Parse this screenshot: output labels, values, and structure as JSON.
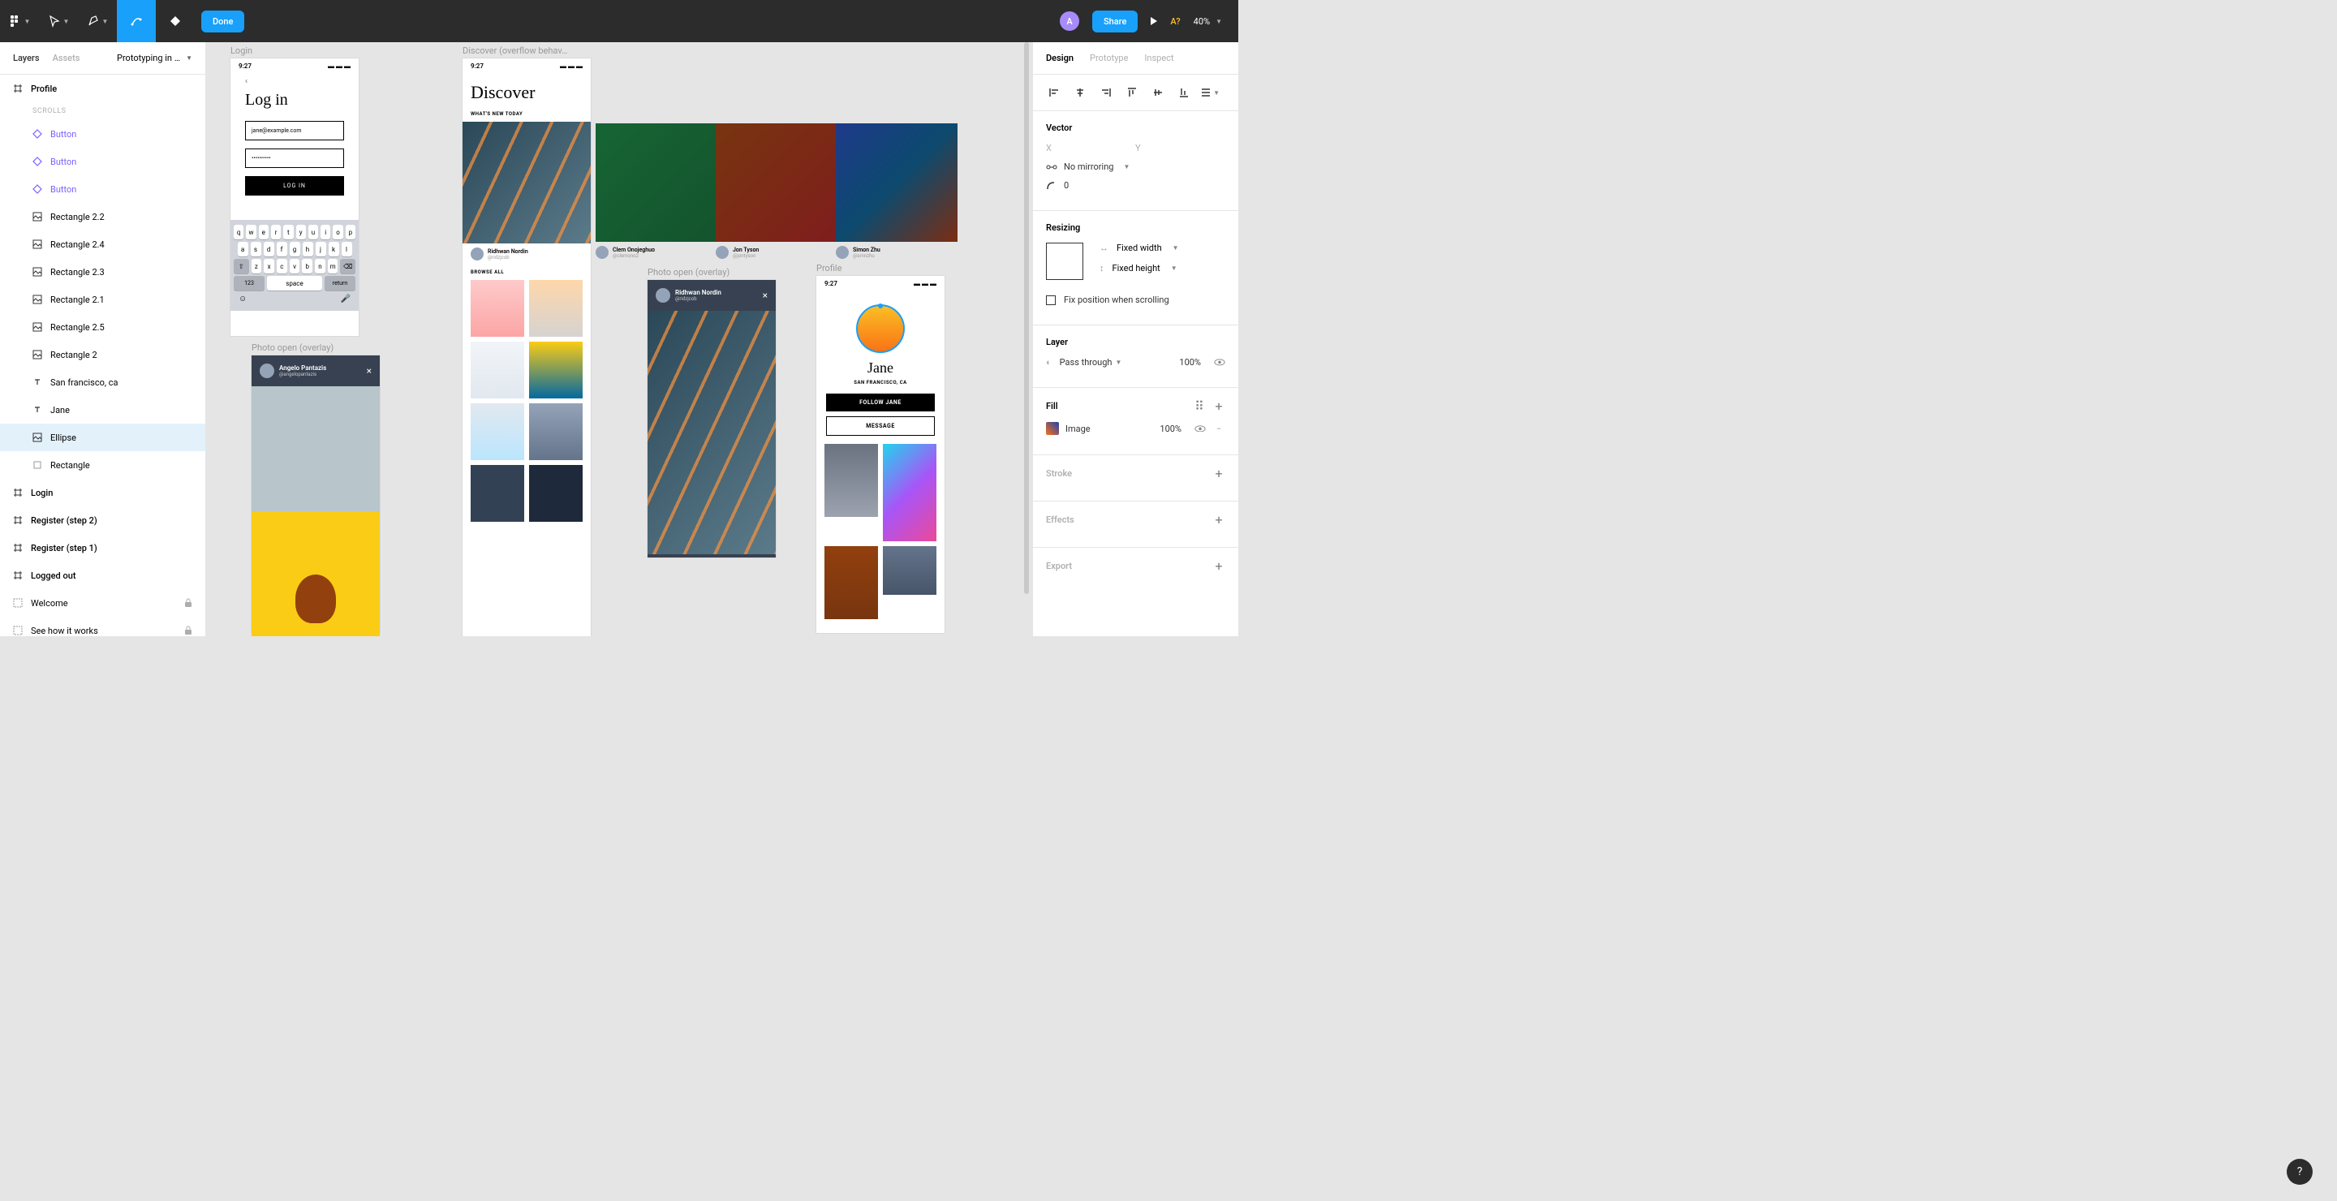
{
  "toolbar": {
    "done": "Done",
    "share": "Share",
    "avatar_initial": "A",
    "missing_font": "A?",
    "zoom": "40%"
  },
  "left_panel": {
    "tabs": {
      "layers": "Layers",
      "assets": "Assets"
    },
    "file_name": "Prototyping in …",
    "section_scrolls": "SCROLLS",
    "layers": [
      {
        "type": "frame",
        "label": "Profile",
        "indent": 0
      },
      {
        "type": "component",
        "label": "Button",
        "indent": 1,
        "purple": true
      },
      {
        "type": "component",
        "label": "Button",
        "indent": 1,
        "purple": true
      },
      {
        "type": "component",
        "label": "Button",
        "indent": 1,
        "purple": true
      },
      {
        "type": "image",
        "label": "Rectangle 2.2",
        "indent": 1
      },
      {
        "type": "image",
        "label": "Rectangle 2.4",
        "indent": 1
      },
      {
        "type": "image",
        "label": "Rectangle 2.3",
        "indent": 1
      },
      {
        "type": "image",
        "label": "Rectangle 2.1",
        "indent": 1
      },
      {
        "type": "image",
        "label": "Rectangle 2.5",
        "indent": 1
      },
      {
        "type": "image",
        "label": "Rectangle 2",
        "indent": 1
      },
      {
        "type": "text",
        "label": "San francisco, ca",
        "indent": 1
      },
      {
        "type": "text",
        "label": "Jane",
        "indent": 1
      },
      {
        "type": "image",
        "label": "Ellipse",
        "indent": 1,
        "selected": true
      },
      {
        "type": "rect",
        "label": "Rectangle",
        "indent": 1
      },
      {
        "type": "frame",
        "label": "Login",
        "indent": 0
      },
      {
        "type": "frame",
        "label": "Register (step 2)",
        "indent": 0
      },
      {
        "type": "frame",
        "label": "Register (step 1)",
        "indent": 0
      },
      {
        "type": "frame",
        "label": "Logged out",
        "indent": 0
      },
      {
        "type": "section",
        "label": "Welcome",
        "indent": 0,
        "locked": true
      },
      {
        "type": "section",
        "label": "See how it works",
        "indent": 0,
        "locked": true
      }
    ]
  },
  "canvas": {
    "frames": {
      "login": {
        "label": "Login",
        "time": "9:27",
        "heading": "Log in",
        "email": "jane@example.com",
        "password": "••••••••••",
        "button": "LOG IN",
        "keyboard": {
          "row1": [
            "q",
            "w",
            "e",
            "r",
            "t",
            "y",
            "u",
            "i",
            "o",
            "p"
          ],
          "row2": [
            "a",
            "s",
            "d",
            "f",
            "g",
            "h",
            "j",
            "k",
            "l"
          ],
          "row3": [
            "z",
            "x",
            "c",
            "v",
            "b",
            "n",
            "m"
          ],
          "bottom": {
            "num": "123",
            "space": "space",
            "return": "return"
          }
        }
      },
      "photo_open1": {
        "label": "Photo open (overlay)",
        "author": "Angelo Pantazis",
        "handle": "@angelopantazis"
      },
      "discover": {
        "label": "Discover (overflow behav…",
        "time": "9:27",
        "heading": "Discover",
        "whats_new": "WHAT'S NEW TODAY",
        "browse_all": "BROWSE ALL",
        "authors": [
          {
            "name": "Ridhwan Nordin",
            "handle": "@ridzjcob"
          },
          {
            "name": "Clem Onojeghuo",
            "handle": "@clemono2"
          },
          {
            "name": "Jon Tyson",
            "handle": "@jontyson"
          },
          {
            "name": "Simon Zhu",
            "handle": "@smnzhu"
          }
        ]
      },
      "photo_open2": {
        "label": "Photo open (overlay)",
        "author": "Ridhwan Nordin",
        "handle": "@ridzjcob"
      },
      "profile": {
        "label": "Profile",
        "time": "9:27",
        "name": "Jane",
        "location": "SAN FRANCISCO, CA",
        "follow": "FOLLOW JANE",
        "message": "MESSAGE"
      }
    }
  },
  "right_panel": {
    "tabs": {
      "design": "Design",
      "prototype": "Prototype",
      "inspect": "Inspect"
    },
    "vector": {
      "title": "Vector",
      "x": "X",
      "y": "Y",
      "mirroring": "No mirroring",
      "corner": "0"
    },
    "resizing": {
      "title": "Resizing",
      "width": "Fixed width",
      "height": "Fixed height",
      "fix_scroll": "Fix position when scrolling"
    },
    "layer": {
      "title": "Layer",
      "blend": "Pass through",
      "opacity": "100%"
    },
    "fill": {
      "title": "Fill",
      "type": "Image",
      "opacity": "100%"
    },
    "stroke": {
      "title": "Stroke"
    },
    "effects": {
      "title": "Effects"
    },
    "export": {
      "title": "Export"
    }
  },
  "help": "?"
}
